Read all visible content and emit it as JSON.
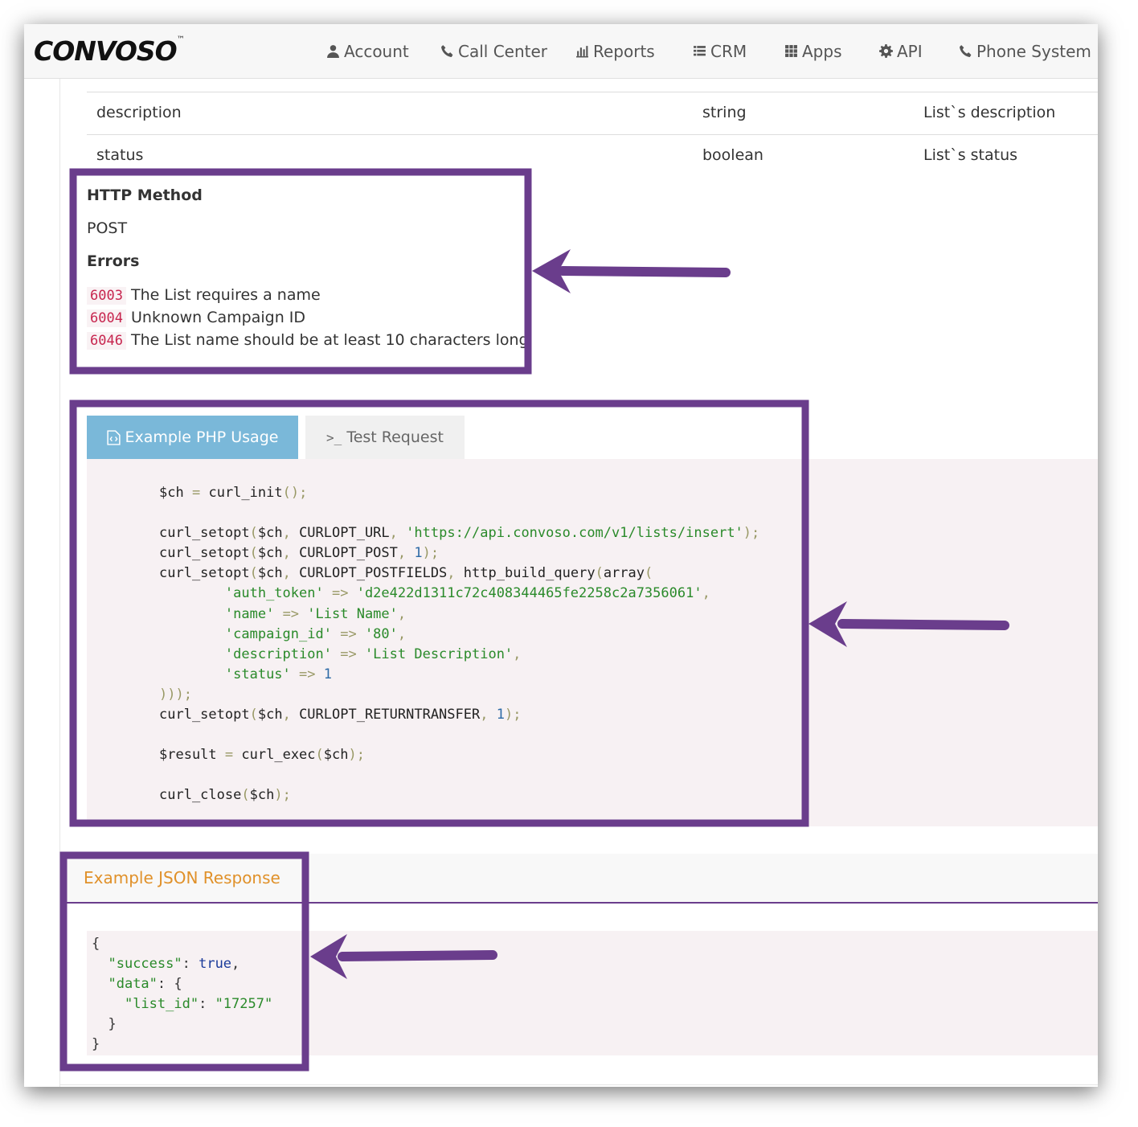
{
  "brand": {
    "logo_text": "CONVOSO",
    "logo_mark": "™"
  },
  "nav": {
    "items": [
      {
        "label": "Account",
        "icon": "user-icon"
      },
      {
        "label": "Call Center",
        "icon": "phone-icon"
      },
      {
        "label": "Reports",
        "icon": "bar-chart-icon"
      },
      {
        "label": "CRM",
        "icon": "list-icon"
      },
      {
        "label": "Apps",
        "icon": "grid-icon"
      },
      {
        "label": "API",
        "icon": "gear-icon"
      },
      {
        "label": "Phone System",
        "icon": "phone-icon"
      }
    ]
  },
  "params_table": {
    "rows": [
      {
        "name": "description",
        "type": "string",
        "desc": "List`s description"
      },
      {
        "name": "status",
        "type": "boolean",
        "desc": "List`s status"
      }
    ]
  },
  "http_method": {
    "heading": "HTTP Method",
    "value": "POST"
  },
  "errors": {
    "heading": "Errors",
    "items": [
      {
        "code": "6003",
        "message": "The List requires a name"
      },
      {
        "code": "6004",
        "message": "Unknown Campaign ID"
      },
      {
        "code": "6046",
        "message": "The List name should be at least 10 characters long"
      }
    ]
  },
  "tabs": {
    "example": {
      "label": "Example PHP Usage",
      "icon": "code-file-icon"
    },
    "test": {
      "label": "Test Request",
      "icon": ">_"
    }
  },
  "php_code": {
    "init_var": "$ch",
    "init_fn": "curl_init",
    "setopt_fn": "curl_setopt",
    "opt_url": "CURLOPT_URL",
    "url": "'https://api.convoso.com/v1/lists/insert'",
    "opt_post": "CURLOPT_POST",
    "one": "1",
    "opt_postfields": "CURLOPT_POSTFIELDS",
    "build_fn": "http_build_query",
    "array_fn": "array",
    "arrow": "=>",
    "fields": [
      {
        "key": "'auth_token'",
        "value": "'d2e422d1311c72c408344465fe2258c2a7356061'"
      },
      {
        "key": "'name'",
        "value": "'List Name'"
      },
      {
        "key": "'campaign_id'",
        "value": "'80'"
      },
      {
        "key": "'description'",
        "value": "'List Description'"
      }
    ],
    "status_key": "'status'",
    "opt_return": "CURLOPT_RETURNTRANSFER",
    "result_var": "$result",
    "exec_fn": "curl_exec",
    "close_fn": "curl_close"
  },
  "json_response": {
    "title": "Example JSON Response",
    "success_key": "\"success\"",
    "success_val": "true",
    "data_key": "\"data\"",
    "list_id_key": "\"list_id\"",
    "list_id_val": "\"17257\""
  },
  "colors": {
    "annotation": "#6a3d8c",
    "tab_active": "#7ab8d9",
    "json_title": "#e0912a"
  }
}
